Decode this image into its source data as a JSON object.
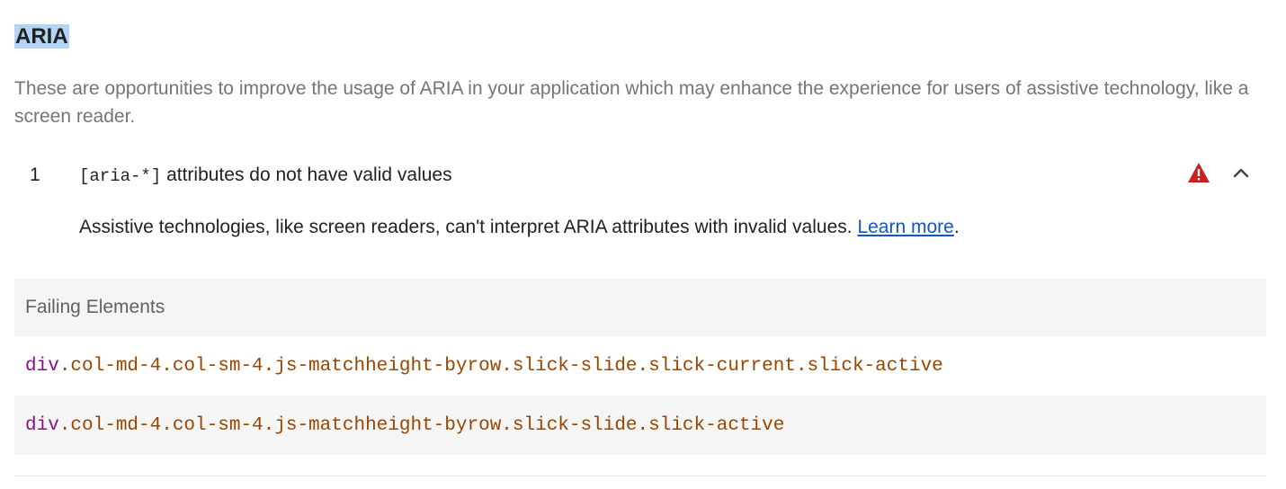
{
  "section": {
    "title": "ARIA",
    "description": "These are opportunities to improve the usage of ARIA in your application which may enhance the experience for users of assistive technology, like a screen reader."
  },
  "audit": {
    "index": "1",
    "title_code": "[aria-*]",
    "title_text": "attributes do not have valid values",
    "status_icon": "warning-triangle-icon",
    "status_color": "#c5221f",
    "expand_icon": "chevron-up-icon",
    "description": "Assistive technologies, like screen readers, can't interpret ARIA attributes with invalid values.",
    "learn_more_label": "Learn more",
    "description_end": "."
  },
  "table": {
    "header": "Failing Elements",
    "rows": [
      {
        "tag": "div",
        "classes": ".col-md-4.col-sm-4.js-matchheight-byrow.slick-slide.slick-current.slick-active"
      },
      {
        "tag": "div",
        "classes": ".col-md-4.col-sm-4.js-matchheight-byrow.slick-slide.slick-active"
      }
    ]
  }
}
